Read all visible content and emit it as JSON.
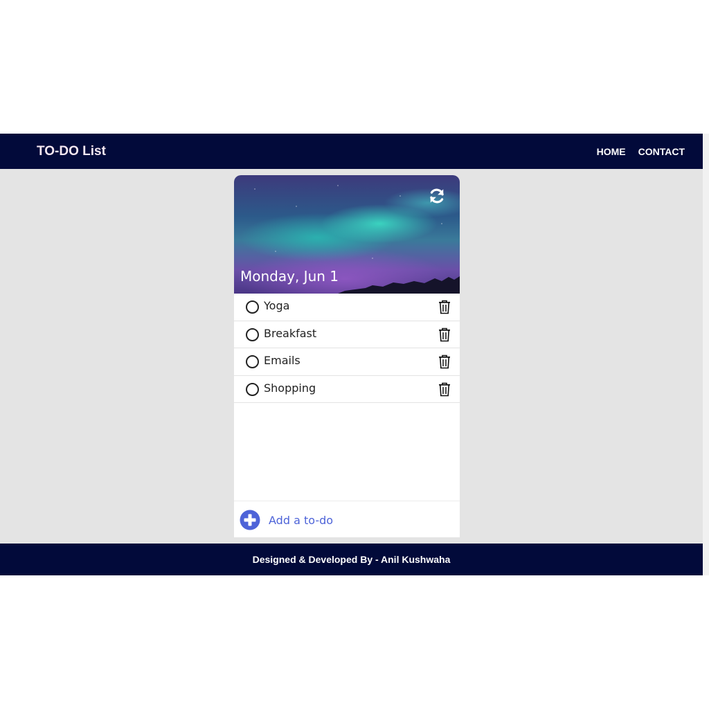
{
  "navbar": {
    "brand": "TO-DO List",
    "links": [
      {
        "label": "HOME"
      },
      {
        "label": "CONTACT"
      }
    ]
  },
  "header": {
    "date": "Monday, Jun 1",
    "refresh_icon": "refresh-icon"
  },
  "todos": [
    {
      "text": "Yoga",
      "done": false
    },
    {
      "text": "Breakfast",
      "done": false
    },
    {
      "text": "Emails",
      "done": false
    },
    {
      "text": "Shopping",
      "done": false
    }
  ],
  "add": {
    "placeholder": "Add a to-do",
    "icon": "plus-circle-icon"
  },
  "footer": {
    "credit": "Designed & Developed By - Anil Kushwaha"
  },
  "colors": {
    "nav_bg": "#020a3a",
    "accent": "#4d63d8",
    "page_bg": "#e4e4e4"
  }
}
